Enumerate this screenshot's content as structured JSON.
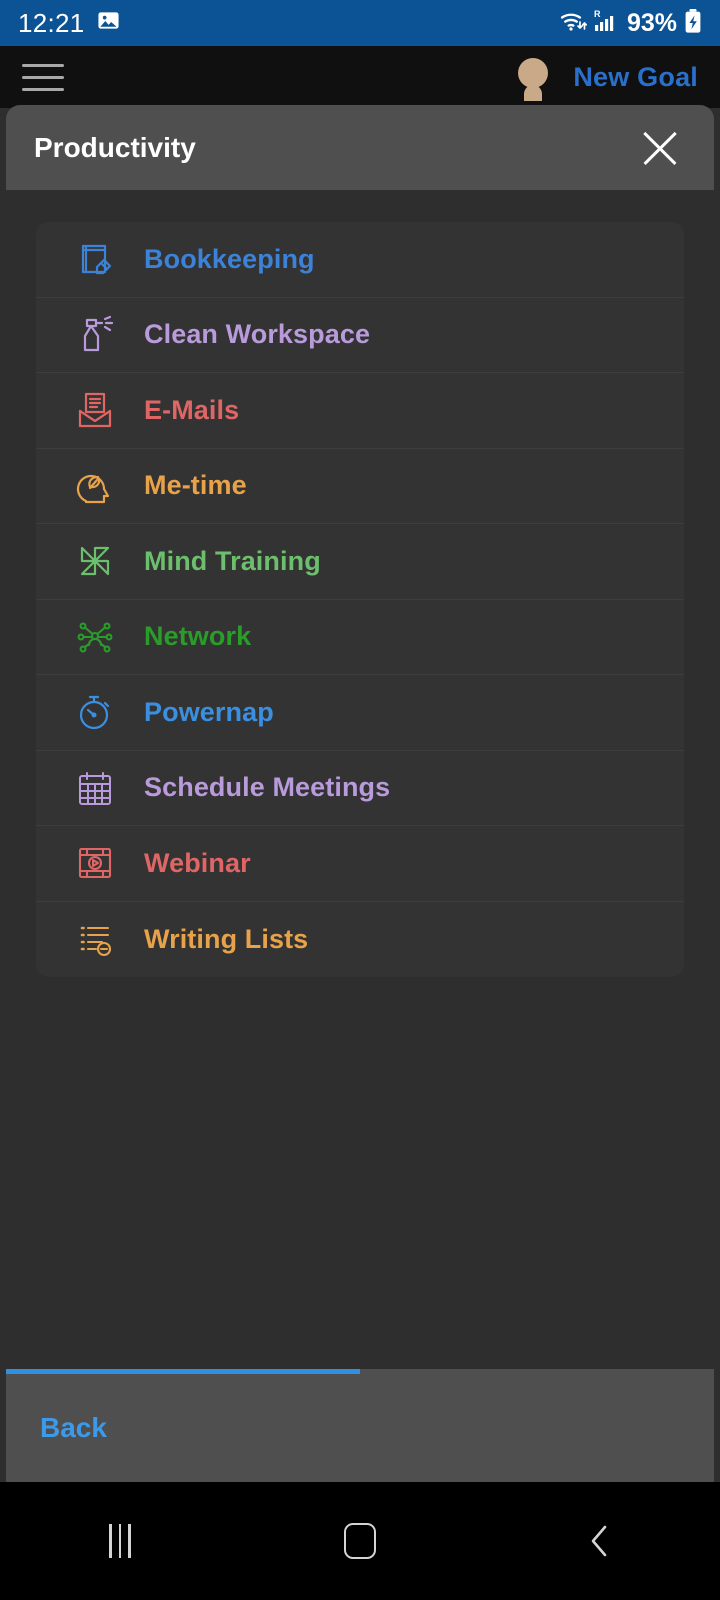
{
  "status_bar": {
    "time": "12:21",
    "battery_percent": "93%",
    "icons": [
      "image-icon",
      "wifi-icon",
      "roaming-signal-icon",
      "battery-charging-icon"
    ],
    "background_color": "#0b5394"
  },
  "app_header": {
    "menu_icon": "hamburger-menu-icon",
    "avatar_icon": "user-avatar-icon",
    "new_goal_label": "New Goal",
    "new_goal_color": "#2a6fc9"
  },
  "sheet": {
    "title": "Productivity",
    "close_icon": "close-icon",
    "header_color": "#4f4f4f",
    "progress_percent": 50,
    "progress_color": "#2f8fe0",
    "back_label": "Back",
    "back_color": "#3d9ae8"
  },
  "goals": [
    {
      "label": "Bookkeeping",
      "color": "#3b82d8",
      "icon": "notebook-pencil-icon"
    },
    {
      "label": "Clean Workspace",
      "color": "#b99bdc",
      "icon": "spray-bottle-icon"
    },
    {
      "label": "E-Mails",
      "color": "#e06666",
      "icon": "envelope-letter-icon"
    },
    {
      "label": "Me-time",
      "color": "#e8a34a",
      "icon": "head-leaf-icon"
    },
    {
      "label": "Mind Training",
      "color": "#6cbf6c",
      "icon": "pinwheel-icon"
    },
    {
      "label": "Network",
      "color": "#2a9c2a",
      "icon": "network-nodes-icon"
    },
    {
      "label": "Powernap",
      "color": "#3b8fe0",
      "icon": "stopwatch-icon"
    },
    {
      "label": "Schedule Meetings",
      "color": "#b99bdc",
      "icon": "calendar-icon"
    },
    {
      "label": "Webinar",
      "color": "#e06666",
      "icon": "video-player-icon"
    },
    {
      "label": "Writing Lists",
      "color": "#e8a34a",
      "icon": "writing-list-icon"
    }
  ],
  "nav_bar": {
    "recents_label": "recents-icon",
    "home_label": "home-icon",
    "back_label": "back-icon"
  }
}
